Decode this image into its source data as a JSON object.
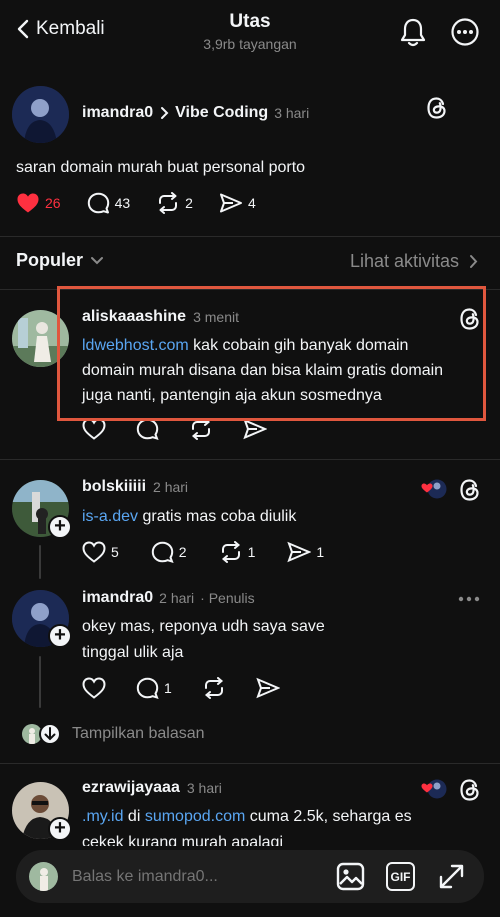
{
  "header": {
    "back_label": "Kembali",
    "title": "Utas",
    "views": "3,9rb tayangan"
  },
  "main_post": {
    "username": "imandra0",
    "topic": "Vibe Coding",
    "time": "3 hari",
    "text": "saran domain murah buat personal porto",
    "likes": "26",
    "replies": "43",
    "reposts": "2",
    "shares": "4"
  },
  "sort": {
    "label": "Populer",
    "activity": "Lihat aktivitas"
  },
  "reply1": {
    "username": "aliskaaashine",
    "time": "3 menit",
    "link": "ldwebhost.com",
    "text_line1": " kak cobain gih banyak domain",
    "text_line2": "domain murah disana dan bisa klaim gratis domain",
    "text_line3": "juga nanti, pantengin aja akun sosmednya"
  },
  "reply2": {
    "username": "bolskiiiii",
    "time": "2 hari",
    "link": "is-a.dev",
    "text": " gratis mas coba diulik",
    "likes": "5",
    "replies": "2",
    "reposts": "1",
    "shares": "1"
  },
  "reply3": {
    "username": "imandra0",
    "time": "2 hari",
    "author_tag": "· Penulis",
    "text_line1": "okey mas, reponya udh saya save",
    "text_line2": "tinggal ulik aja",
    "replies": "1",
    "show_replies": "Tampilkan balasan"
  },
  "reply4": {
    "username": "ezrawijayaaa",
    "time": "3 hari",
    "link1": ".my.id",
    "mid": " di ",
    "link2": "sumopod.com",
    "text_rest": " cuma 2.5k, seharga es",
    "text_line2": "cekek kurang murah apalagi"
  },
  "composer": {
    "placeholder": "Balas ke imandra0...",
    "gif_label": "GIF"
  },
  "colors": {
    "background": "#101010",
    "accent_link": "#5aa6f2",
    "like_red": "#ff3040",
    "highlight_box": "#e0573e"
  }
}
